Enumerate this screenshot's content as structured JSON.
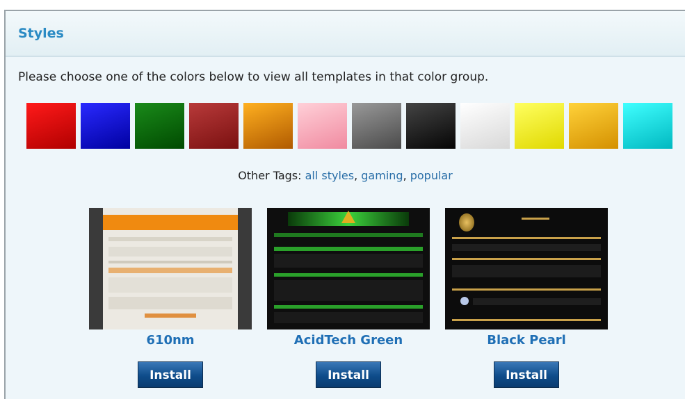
{
  "panel": {
    "title": "Styles",
    "intro": "Please choose one of the colors below to view all templates in that color group."
  },
  "swatches": [
    {
      "name": "red",
      "top": "#ff1a1a",
      "bottom": "#b00000"
    },
    {
      "name": "blue",
      "top": "#2a2aff",
      "bottom": "#0000a0"
    },
    {
      "name": "green",
      "top": "#1a8a1a",
      "bottom": "#004a00"
    },
    {
      "name": "dark-red",
      "top": "#b83a3a",
      "bottom": "#7a1010"
    },
    {
      "name": "orange",
      "top": "#ffb020",
      "bottom": "#b05a00"
    },
    {
      "name": "pink",
      "top": "#ffd0d8",
      "bottom": "#f08aa0"
    },
    {
      "name": "gray",
      "top": "#999999",
      "bottom": "#4a4a4a"
    },
    {
      "name": "black",
      "top": "#444444",
      "bottom": "#050505"
    },
    {
      "name": "white",
      "top": "#ffffff",
      "bottom": "#d8d8d8"
    },
    {
      "name": "yellow",
      "top": "#ffff60",
      "bottom": "#e0d800"
    },
    {
      "name": "gold",
      "top": "#ffd23a",
      "bottom": "#d49000"
    },
    {
      "name": "cyan",
      "top": "#40ffff",
      "bottom": "#00b8c0"
    }
  ],
  "tags": {
    "label": "Other Tags:",
    "links": [
      "all styles",
      "gaming",
      "popular"
    ]
  },
  "templates": [
    {
      "name": "610nm",
      "install_label": "Install",
      "accent": "#f08a10",
      "bg": "#ece9e2"
    },
    {
      "name": "AcidTech Green",
      "install_label": "Install",
      "accent": "#3cd23c",
      "bg": "#111111"
    },
    {
      "name": "Black Pearl",
      "install_label": "Install",
      "accent": "#c9a14a",
      "bg": "#0c0c0c"
    }
  ]
}
